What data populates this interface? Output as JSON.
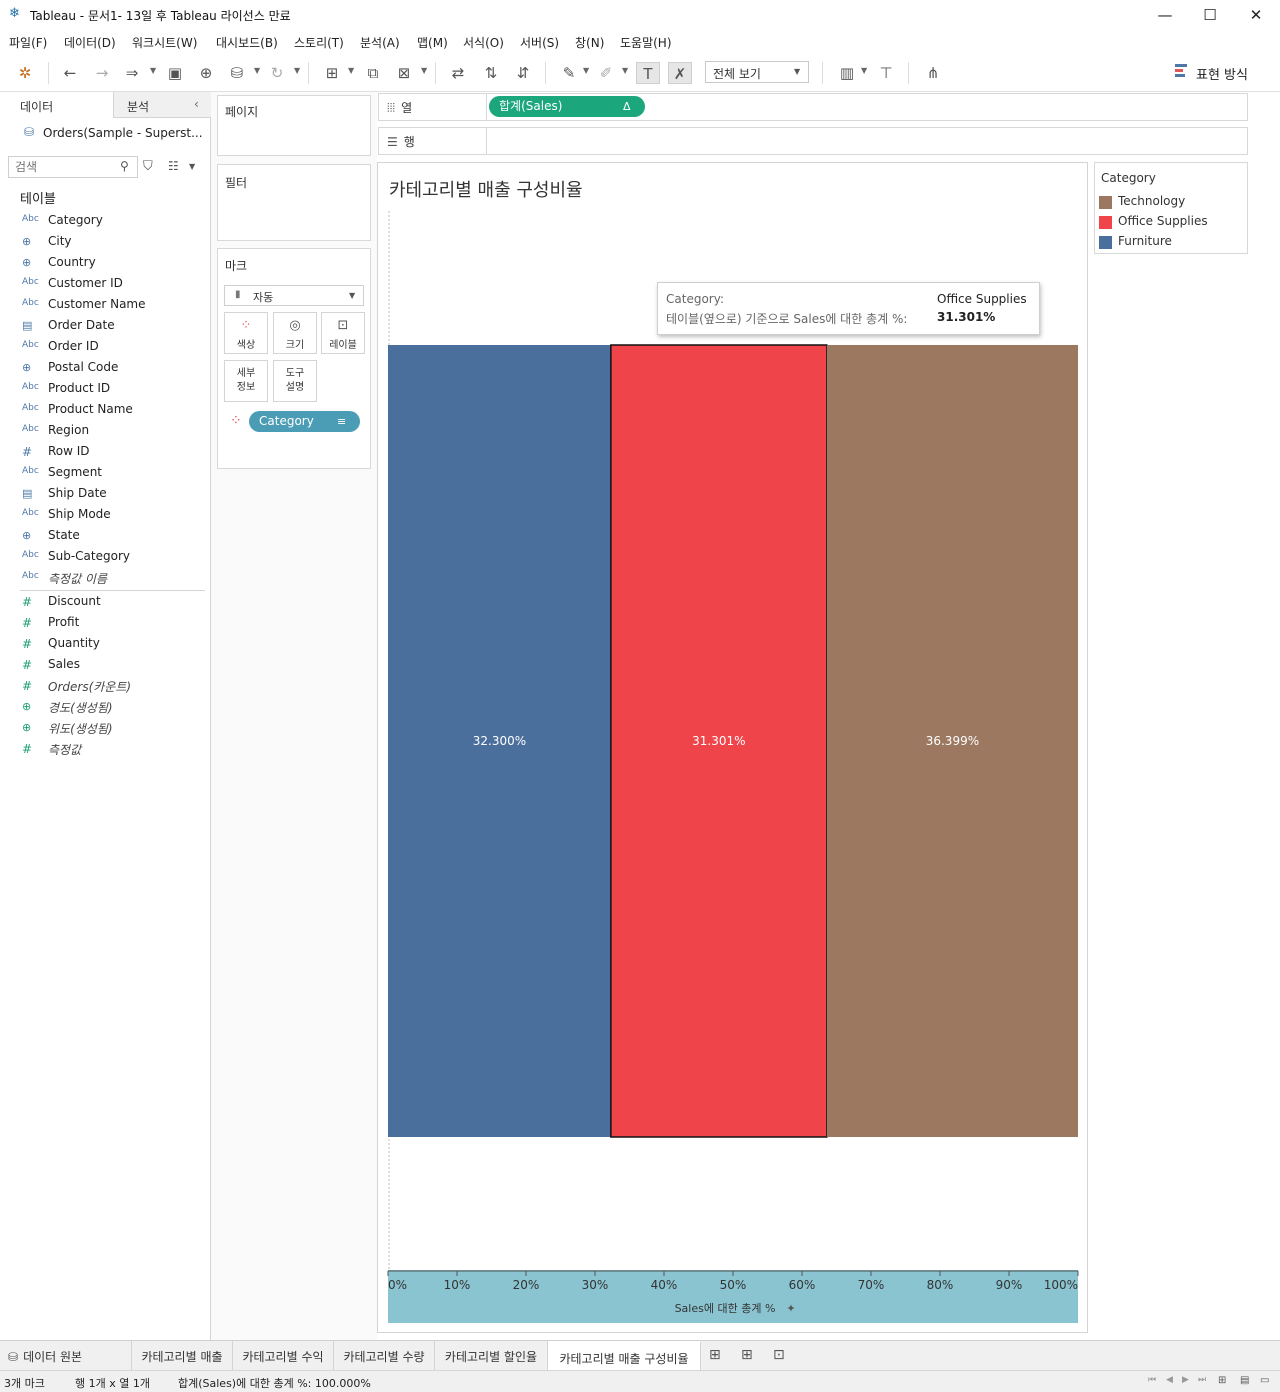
{
  "window": {
    "title": "Tableau - 문서1- 13일 후 Tableau 라이선스 만료"
  },
  "menu": [
    "파일(F)",
    "데이터(D)",
    "워크시트(W)",
    "대시보드(B)",
    "스토리(T)",
    "분석(A)",
    "맵(M)",
    "서식(O)",
    "서버(S)",
    "창(N)",
    "도움말(H)"
  ],
  "toolbar": {
    "view_mode": "전체 보기",
    "show_me": "표현 방식"
  },
  "left": {
    "tab_data": "데이터",
    "tab_analysis": "분석",
    "datasource": "Orders(Sample - Superst...",
    "search_placeholder": "검색",
    "tables_header": "테이블",
    "dim_icon": "Abc",
    "dimensions": [
      {
        "name": "Category",
        "type": "abc"
      },
      {
        "name": "City",
        "type": "geo"
      },
      {
        "name": "Country",
        "type": "geo"
      },
      {
        "name": "Customer ID",
        "type": "abc"
      },
      {
        "name": "Customer Name",
        "type": "abc"
      },
      {
        "name": "Order Date",
        "type": "date"
      },
      {
        "name": "Order ID",
        "type": "abc"
      },
      {
        "name": "Postal Code",
        "type": "geo"
      },
      {
        "name": "Product ID",
        "type": "abc"
      },
      {
        "name": "Product Name",
        "type": "abc"
      },
      {
        "name": "Region",
        "type": "abc"
      },
      {
        "name": "Row ID",
        "type": "num"
      },
      {
        "name": "Segment",
        "type": "abc"
      },
      {
        "name": "Ship Date",
        "type": "date"
      },
      {
        "name": "Ship Mode",
        "type": "abc"
      },
      {
        "name": "State",
        "type": "geo"
      },
      {
        "name": "Sub-Category",
        "type": "abc"
      },
      {
        "name": "측정값 이름",
        "type": "abc",
        "italic": true
      }
    ],
    "measures": [
      {
        "name": "Discount",
        "type": "num"
      },
      {
        "name": "Profit",
        "type": "num"
      },
      {
        "name": "Quantity",
        "type": "num"
      },
      {
        "name": "Sales",
        "type": "num"
      },
      {
        "name": "Orders(카운트)",
        "type": "num",
        "italic": true
      },
      {
        "name": "경도(생성됨)",
        "type": "geo",
        "italic": true
      },
      {
        "name": "위도(생성됨)",
        "type": "geo",
        "italic": true
      },
      {
        "name": "측정값",
        "type": "num",
        "italic": true
      }
    ]
  },
  "shelves": {
    "pages": "페이지",
    "filters": "필터",
    "marks": "마크",
    "mark_type": "자동",
    "mark_buttons": [
      "색상",
      "크기",
      "레이블",
      "세부\n정보",
      "도구\n설명"
    ],
    "category_pill": "Category",
    "columns_label": "열",
    "columns_pill": "합계(Sales)",
    "columns_pill_icon": "Δ",
    "rows_label": "행"
  },
  "colors": {
    "furniture": "#4a6f9c",
    "office_supplies": "#ee444a",
    "technology": "#9c7860",
    "axis_band": "#8bc4d1",
    "pill_green": "#1ba67b",
    "pill_blue": "#4a9db5"
  },
  "view": {
    "title": "카테고리별 매출 구성비율"
  },
  "legend": {
    "title": "Category",
    "items": [
      {
        "label": "Technology",
        "color": "#9c7860"
      },
      {
        "label": "Office Supplies",
        "color": "#ee444a"
      },
      {
        "label": "Furniture",
        "color": "#4a6f9c"
      }
    ]
  },
  "tooltip": {
    "key1": "Category:",
    "val1": "Office Supplies",
    "key2": "테이블(옆으로) 기준으로 Sales에 대한 총계 %:",
    "val2": "31.301%"
  },
  "chart_data": {
    "type": "bar",
    "orientation": "horizontal-stacked",
    "series": [
      {
        "name": "Furniture",
        "values": [
          32.3
        ],
        "label": "32.300%"
      },
      {
        "name": "Office Supplies",
        "values": [
          31.301
        ],
        "label": "31.301%"
      },
      {
        "name": "Technology",
        "values": [
          36.399
        ],
        "label": "36.399%"
      }
    ],
    "xlabel": "Sales에 대한 총계 %",
    "xlim": [
      0,
      100
    ],
    "xticks": [
      "0%",
      "10%",
      "20%",
      "30%",
      "40%",
      "50%",
      "60%",
      "70%",
      "80%",
      "90%",
      "100%"
    ],
    "highlighted": "Office Supplies"
  },
  "sheet_tabs": [
    "데이터 원본",
    "카테고리별 매출",
    "카테고리별 수익",
    "카테고리별 수량",
    "카테고리별 할인율",
    "카테고리별 매출 구성비율"
  ],
  "status": {
    "marks": "3개 마크",
    "rowscols": "행 1개 x 열 1개",
    "sum": "합계(Sales)에 대한 총계 %: 100.000%"
  }
}
